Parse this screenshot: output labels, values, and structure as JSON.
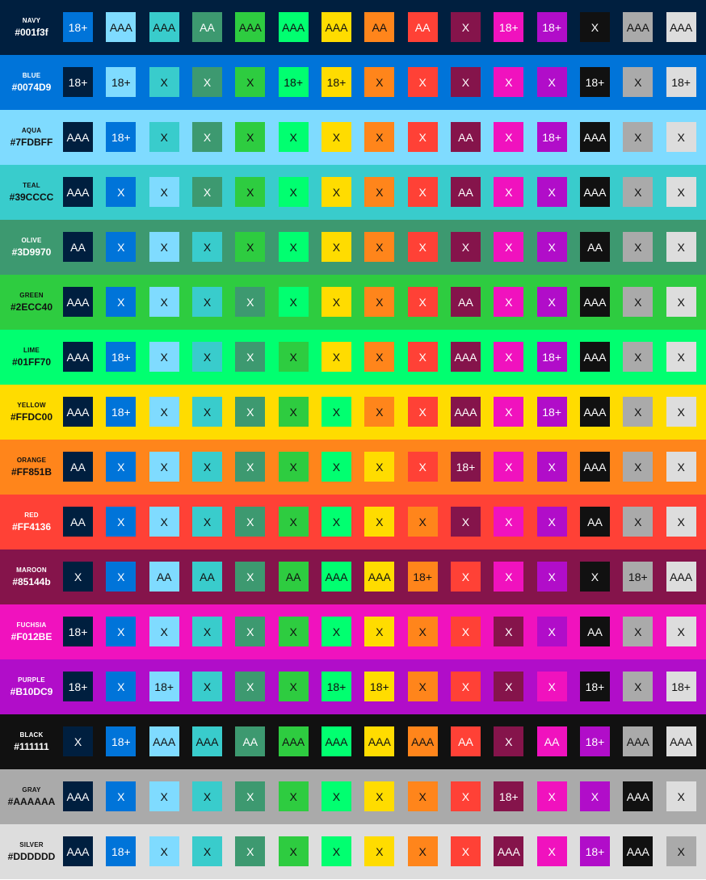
{
  "colors": [
    {
      "name": "NAVY",
      "hex": "#001f3f",
      "color": "#001f3f",
      "text_color": "#ffffff"
    },
    {
      "name": "BLUE",
      "hex": "#0074D9",
      "color": "#0074D9",
      "text_color": "#ffffff"
    },
    {
      "name": "AQUA",
      "hex": "#7FDBFF",
      "color": "#7FDBFF",
      "text_color": "#111111"
    },
    {
      "name": "TEAL",
      "hex": "#39CCCC",
      "color": "#39CCCC",
      "text_color": "#111111"
    },
    {
      "name": "OLIVE",
      "hex": "#3D9970",
      "color": "#3D9970",
      "text_color": "#ffffff"
    },
    {
      "name": "GREEN",
      "hex": "#2ECC40",
      "color": "#2ECC40",
      "text_color": "#111111"
    },
    {
      "name": "LIME",
      "hex": "#01FF70",
      "color": "#01FF70",
      "text_color": "#111111"
    },
    {
      "name": "YELLOW",
      "hex": "#FFDC00",
      "color": "#FFDC00",
      "text_color": "#111111"
    },
    {
      "name": "ORANGE",
      "hex": "#FF851B",
      "color": "#FF851B",
      "text_color": "#111111"
    },
    {
      "name": "RED",
      "hex": "#FF4136",
      "color": "#FF4136",
      "text_color": "#ffffff"
    },
    {
      "name": "MAROON",
      "hex": "#85144b",
      "color": "#85144b",
      "text_color": "#ffffff"
    },
    {
      "name": "FUCHSIA",
      "hex": "#F012BE",
      "color": "#F012BE",
      "text_color": "#ffffff"
    },
    {
      "name": "PURPLE",
      "hex": "#B10DC9",
      "color": "#B10DC9",
      "text_color": "#ffffff"
    },
    {
      "name": "BLACK",
      "hex": "#111111",
      "color": "#111111",
      "text_color": "#ffffff"
    },
    {
      "name": "GRAY",
      "hex": "#AAAAAA",
      "color": "#AAAAAA",
      "text_color": "#111111"
    },
    {
      "name": "SILVER",
      "hex": "#DDDDDD",
      "color": "#DDDDDD",
      "text_color": "#111111"
    }
  ],
  "rows": [
    {
      "name": "NAVY",
      "hex": "#001f3f",
      "bg": "#001f3f",
      "label_color": "#ffffff",
      "cells": [
        "18+",
        "AAA",
        "AAA",
        "AA",
        "AAA",
        "AAA",
        "AAA",
        "AA",
        "AA",
        "X",
        "18+",
        "18+",
        "X",
        "AAA",
        "AAA"
      ]
    },
    {
      "name": "BLUE",
      "hex": "#0074D9",
      "bg": "#0074D9",
      "label_color": "#ffffff",
      "cells": [
        "18+",
        "18+",
        "X",
        "X",
        "X",
        "18+",
        "18+",
        "X",
        "X",
        "X",
        "X",
        "X",
        "18+",
        "X",
        "18+"
      ]
    },
    {
      "name": "AQUA",
      "hex": "#7FDBFF",
      "bg": "#7FDBFF",
      "label_color": "#111111",
      "cells": [
        "AAA",
        "18+",
        "X",
        "X",
        "X",
        "X",
        "X",
        "X",
        "X",
        "AA",
        "X",
        "18+",
        "AAA",
        "X",
        "X"
      ]
    },
    {
      "name": "TEAL",
      "hex": "#39CCCC",
      "bg": "#39CCCC",
      "label_color": "#111111",
      "cells": [
        "AAA",
        "X",
        "X",
        "X",
        "X",
        "X",
        "X",
        "X",
        "X",
        "AA",
        "X",
        "X",
        "AAA",
        "X",
        "X"
      ]
    },
    {
      "name": "OLIVE",
      "hex": "#3D9970",
      "bg": "#3D9970",
      "label_color": "#ffffff",
      "cells": [
        "AA",
        "X",
        "X",
        "X",
        "X",
        "X",
        "X",
        "X",
        "X",
        "X",
        "X",
        "X",
        "AA",
        "X",
        "X"
      ]
    },
    {
      "name": "GREEN",
      "hex": "#2ECC40",
      "bg": "#2ECC40",
      "label_color": "#111111",
      "cells": [
        "AAA",
        "X",
        "X",
        "X",
        "X",
        "X",
        "X",
        "X",
        "X",
        "AA",
        "X",
        "X",
        "AAA",
        "X",
        "X"
      ]
    },
    {
      "name": "LIME",
      "hex": "#01FF70",
      "bg": "#01FF70",
      "label_color": "#111111",
      "cells": [
        "AAA",
        "18+",
        "X",
        "X",
        "X",
        "X",
        "X",
        "X",
        "X",
        "AAA",
        "X",
        "18+",
        "AAA",
        "X",
        "X"
      ]
    },
    {
      "name": "YELLOW",
      "hex": "#FFDC00",
      "bg": "#FFDC00",
      "label_color": "#111111",
      "cells": [
        "AAA",
        "18+",
        "X",
        "X",
        "X",
        "X",
        "X",
        "X",
        "X",
        "AAA",
        "X",
        "18+",
        "AAA",
        "X",
        "X"
      ]
    },
    {
      "name": "ORANGE",
      "hex": "#FF851B",
      "bg": "#FF851B",
      "label_color": "#111111",
      "cells": [
        "AA",
        "X",
        "X",
        "X",
        "X",
        "X",
        "X",
        "X",
        "X",
        "18+",
        "X",
        "X",
        "AAA",
        "X",
        "X"
      ]
    },
    {
      "name": "RED",
      "hex": "#FF4136",
      "bg": "#FF4136",
      "label_color": "#ffffff",
      "cells": [
        "AA",
        "X",
        "X",
        "X",
        "X",
        "X",
        "X",
        "X",
        "X",
        "X",
        "X",
        "X",
        "AA",
        "X",
        "X"
      ]
    },
    {
      "name": "MAROON",
      "hex": "#85144b",
      "bg": "#85144b",
      "label_color": "#ffffff",
      "cells": [
        "X",
        "X",
        "AA",
        "AA",
        "X",
        "AA",
        "AAA",
        "AAA",
        "18+",
        "X",
        "X",
        "X",
        "X",
        "18+",
        "AAA"
      ]
    },
    {
      "name": "FUCHSIA",
      "hex": "#F012BE",
      "bg": "#F012BE",
      "label_color": "#ffffff",
      "cells": [
        "18+",
        "X",
        "X",
        "X",
        "X",
        "X",
        "X",
        "X",
        "X",
        "X",
        "X",
        "X",
        "AA",
        "X",
        "X"
      ]
    },
    {
      "name": "PURPLE",
      "hex": "#B10DC9",
      "bg": "#B10DC9",
      "label_color": "#ffffff",
      "cells": [
        "18+",
        "X",
        "18+",
        "X",
        "X",
        "X",
        "18+",
        "18+",
        "X",
        "X",
        "X",
        "X",
        "18+",
        "X",
        "18+"
      ]
    },
    {
      "name": "BLACK",
      "hex": "#111111",
      "bg": "#111111",
      "label_color": "#ffffff",
      "cells": [
        "X",
        "18+",
        "AAA",
        "AAA",
        "AA",
        "AAA",
        "AAA",
        "AAA",
        "AAA",
        "AA",
        "X",
        "AA",
        "18+",
        "AAA",
        "AAA"
      ]
    },
    {
      "name": "GRAY",
      "hex": "#AAAAAA",
      "bg": "#AAAAAA",
      "label_color": "#111111",
      "cells": [
        "AAA",
        "X",
        "X",
        "X",
        "X",
        "X",
        "X",
        "X",
        "X",
        "X",
        "18+",
        "X",
        "X",
        "AAA",
        "X"
      ]
    },
    {
      "name": "SILVER",
      "hex": "#DDDDDD",
      "bg": "#DDDDDD",
      "label_color": "#111111",
      "cells": [
        "AAA",
        "18+",
        "X",
        "X",
        "X",
        "X",
        "X",
        "X",
        "X",
        "X",
        "AAA",
        "X",
        "18+",
        "AAA",
        "X"
      ]
    }
  ]
}
